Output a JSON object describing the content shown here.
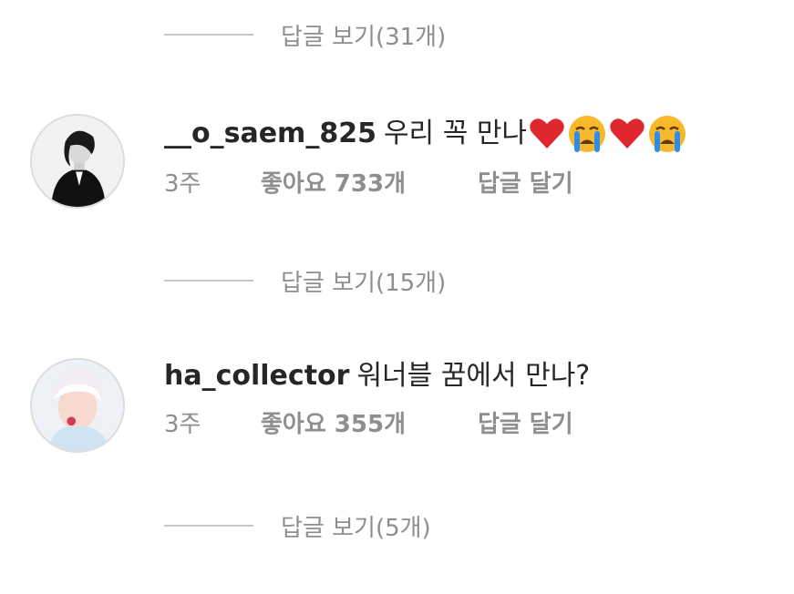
{
  "replies_1": "답글 보기(31개)",
  "comments": [
    {
      "username": "__o_saem_825",
      "text": "우리 꼭 만나",
      "emojis": [
        "heart-icon",
        "crying-face-icon",
        "heart-icon",
        "crying-face-icon"
      ],
      "time": "3주",
      "likes": "좋아요 733개",
      "reply": "답글 달기",
      "replies": "답글 보기(15개)"
    },
    {
      "username": "ha_collector",
      "text": "워너블 꿈에서 만나?",
      "emojis": [],
      "time": "3주",
      "likes": "좋아요 355개",
      "reply": "답글 달기",
      "replies": "답글 보기(5개)"
    }
  ],
  "colors": {
    "text": "#262626",
    "muted": "#8e8e8e",
    "divider": "#c7c7c7",
    "heart": "#e0262f",
    "emoji_face": "#f6b92b",
    "tears": "#2f8ce8"
  }
}
